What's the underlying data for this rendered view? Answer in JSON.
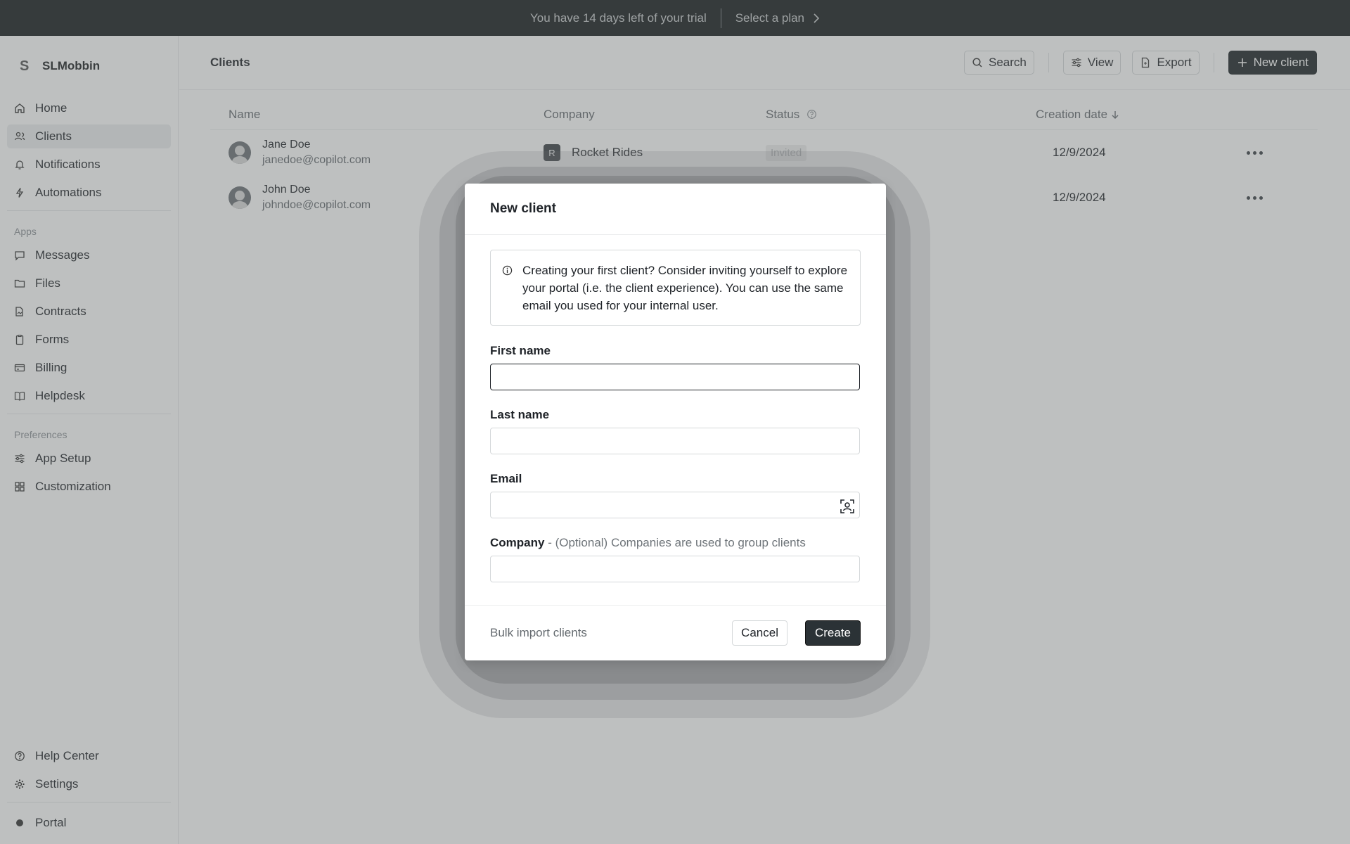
{
  "topbar": {
    "trial_text": "You have 14 days left of your trial",
    "plan_link": "Select a plan"
  },
  "sidebar": {
    "brand": "SLMobbin",
    "brand_icon": "S",
    "main_items": [
      {
        "label": "Home",
        "icon": "home-icon"
      },
      {
        "label": "Clients",
        "icon": "users-icon",
        "active": true
      },
      {
        "label": "Notifications",
        "icon": "bell-icon"
      },
      {
        "label": "Automations",
        "icon": "bolt-icon"
      }
    ],
    "apps_label": "Apps",
    "apps_items": [
      {
        "label": "Messages",
        "icon": "message-icon"
      },
      {
        "label": "Files",
        "icon": "folder-icon"
      },
      {
        "label": "Contracts",
        "icon": "contract-icon"
      },
      {
        "label": "Forms",
        "icon": "clipboard-icon"
      },
      {
        "label": "Billing",
        "icon": "card-icon"
      },
      {
        "label": "Helpdesk",
        "icon": "book-icon"
      }
    ],
    "preferences_label": "Preferences",
    "pref_items": [
      {
        "label": "App Setup",
        "icon": "sliders-icon"
      },
      {
        "label": "Customization",
        "icon": "grid-icon"
      }
    ],
    "bottom_items": [
      {
        "label": "Help Center",
        "icon": "help-icon"
      },
      {
        "label": "Settings",
        "icon": "gear-icon"
      }
    ],
    "portal_label": "Portal"
  },
  "header": {
    "title": "Clients",
    "search_label": "Search",
    "view_label": "View",
    "export_label": "Export",
    "new_client_label": "New client"
  },
  "table": {
    "columns": {
      "name": "Name",
      "company": "Company",
      "status": "Status",
      "creation_date": "Creation date"
    },
    "rows": [
      {
        "name": "Jane Doe",
        "email": "janedoe@copilot.com",
        "company": "Rocket Rides",
        "company_initial": "R",
        "status": "Invited",
        "date": "12/9/2024"
      },
      {
        "name": "John Doe",
        "email": "johndoe@copilot.com",
        "company": "",
        "company_initial": "",
        "status": "",
        "date": "12/9/2024"
      }
    ]
  },
  "modal": {
    "title": "New client",
    "info_text": "Creating your first client? Consider inviting yourself to explore your portal (i.e. the client experience). You can use the same email you used for your internal user.",
    "first_name_label": "First name",
    "first_name_value": "",
    "last_name_label": "Last name",
    "last_name_value": "",
    "email_label": "Email",
    "email_value": "",
    "company_label": "Company",
    "company_hint": " - (Optional) Companies are used to group clients",
    "company_value": "",
    "bulk_import": "Bulk import clients",
    "cancel": "Cancel",
    "create": "Create"
  }
}
